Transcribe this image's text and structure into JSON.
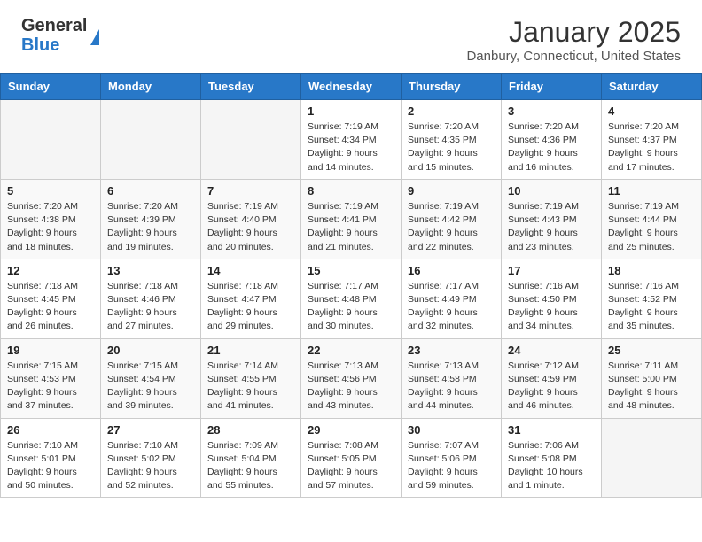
{
  "header": {
    "logo_general": "General",
    "logo_blue": "Blue",
    "month_year": "January 2025",
    "location": "Danbury, Connecticut, United States"
  },
  "days_of_week": [
    "Sunday",
    "Monday",
    "Tuesday",
    "Wednesday",
    "Thursday",
    "Friday",
    "Saturday"
  ],
  "weeks": [
    [
      {
        "day": "",
        "empty": true
      },
      {
        "day": "",
        "empty": true
      },
      {
        "day": "",
        "empty": true
      },
      {
        "day": "1",
        "sunrise": "7:19 AM",
        "sunset": "4:34 PM",
        "daylight": "9 hours and 14 minutes."
      },
      {
        "day": "2",
        "sunrise": "7:20 AM",
        "sunset": "4:35 PM",
        "daylight": "9 hours and 15 minutes."
      },
      {
        "day": "3",
        "sunrise": "7:20 AM",
        "sunset": "4:36 PM",
        "daylight": "9 hours and 16 minutes."
      },
      {
        "day": "4",
        "sunrise": "7:20 AM",
        "sunset": "4:37 PM",
        "daylight": "9 hours and 17 minutes."
      }
    ],
    [
      {
        "day": "5",
        "sunrise": "7:20 AM",
        "sunset": "4:38 PM",
        "daylight": "9 hours and 18 minutes."
      },
      {
        "day": "6",
        "sunrise": "7:20 AM",
        "sunset": "4:39 PM",
        "daylight": "9 hours and 19 minutes."
      },
      {
        "day": "7",
        "sunrise": "7:19 AM",
        "sunset": "4:40 PM",
        "daylight": "9 hours and 20 minutes."
      },
      {
        "day": "8",
        "sunrise": "7:19 AM",
        "sunset": "4:41 PM",
        "daylight": "9 hours and 21 minutes."
      },
      {
        "day": "9",
        "sunrise": "7:19 AM",
        "sunset": "4:42 PM",
        "daylight": "9 hours and 22 minutes."
      },
      {
        "day": "10",
        "sunrise": "7:19 AM",
        "sunset": "4:43 PM",
        "daylight": "9 hours and 23 minutes."
      },
      {
        "day": "11",
        "sunrise": "7:19 AM",
        "sunset": "4:44 PM",
        "daylight": "9 hours and 25 minutes."
      }
    ],
    [
      {
        "day": "12",
        "sunrise": "7:18 AM",
        "sunset": "4:45 PM",
        "daylight": "9 hours and 26 minutes."
      },
      {
        "day": "13",
        "sunrise": "7:18 AM",
        "sunset": "4:46 PM",
        "daylight": "9 hours and 27 minutes."
      },
      {
        "day": "14",
        "sunrise": "7:18 AM",
        "sunset": "4:47 PM",
        "daylight": "9 hours and 29 minutes."
      },
      {
        "day": "15",
        "sunrise": "7:17 AM",
        "sunset": "4:48 PM",
        "daylight": "9 hours and 30 minutes."
      },
      {
        "day": "16",
        "sunrise": "7:17 AM",
        "sunset": "4:49 PM",
        "daylight": "9 hours and 32 minutes."
      },
      {
        "day": "17",
        "sunrise": "7:16 AM",
        "sunset": "4:50 PM",
        "daylight": "9 hours and 34 minutes."
      },
      {
        "day": "18",
        "sunrise": "7:16 AM",
        "sunset": "4:52 PM",
        "daylight": "9 hours and 35 minutes."
      }
    ],
    [
      {
        "day": "19",
        "sunrise": "7:15 AM",
        "sunset": "4:53 PM",
        "daylight": "9 hours and 37 minutes."
      },
      {
        "day": "20",
        "sunrise": "7:15 AM",
        "sunset": "4:54 PM",
        "daylight": "9 hours and 39 minutes."
      },
      {
        "day": "21",
        "sunrise": "7:14 AM",
        "sunset": "4:55 PM",
        "daylight": "9 hours and 41 minutes."
      },
      {
        "day": "22",
        "sunrise": "7:13 AM",
        "sunset": "4:56 PM",
        "daylight": "9 hours and 43 minutes."
      },
      {
        "day": "23",
        "sunrise": "7:13 AM",
        "sunset": "4:58 PM",
        "daylight": "9 hours and 44 minutes."
      },
      {
        "day": "24",
        "sunrise": "7:12 AM",
        "sunset": "4:59 PM",
        "daylight": "9 hours and 46 minutes."
      },
      {
        "day": "25",
        "sunrise": "7:11 AM",
        "sunset": "5:00 PM",
        "daylight": "9 hours and 48 minutes."
      }
    ],
    [
      {
        "day": "26",
        "sunrise": "7:10 AM",
        "sunset": "5:01 PM",
        "daylight": "9 hours and 50 minutes."
      },
      {
        "day": "27",
        "sunrise": "7:10 AM",
        "sunset": "5:02 PM",
        "daylight": "9 hours and 52 minutes."
      },
      {
        "day": "28",
        "sunrise": "7:09 AM",
        "sunset": "5:04 PM",
        "daylight": "9 hours and 55 minutes."
      },
      {
        "day": "29",
        "sunrise": "7:08 AM",
        "sunset": "5:05 PM",
        "daylight": "9 hours and 57 minutes."
      },
      {
        "day": "30",
        "sunrise": "7:07 AM",
        "sunset": "5:06 PM",
        "daylight": "9 hours and 59 minutes."
      },
      {
        "day": "31",
        "sunrise": "7:06 AM",
        "sunset": "5:08 PM",
        "daylight": "10 hours and 1 minute."
      },
      {
        "day": "",
        "empty": true
      }
    ]
  ]
}
